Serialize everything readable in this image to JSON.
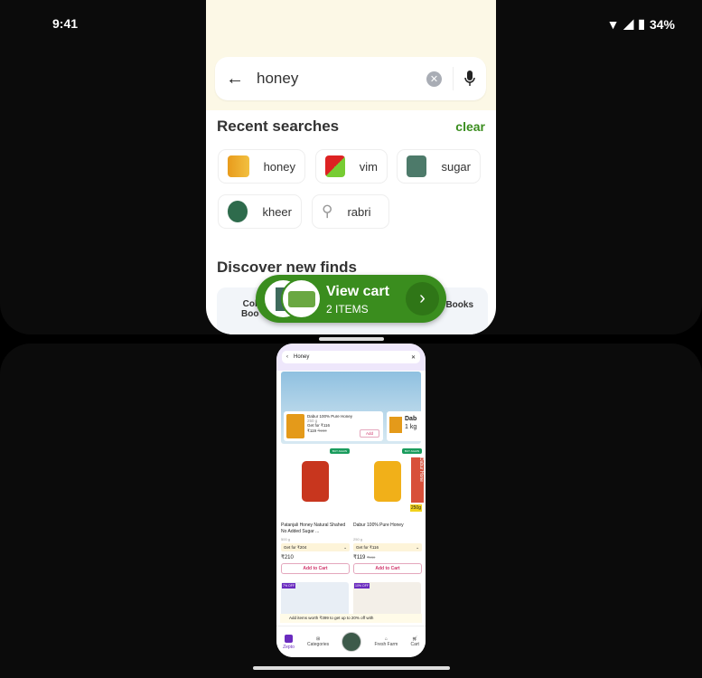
{
  "status": {
    "time": "9:41",
    "battery": "34%"
  },
  "search": {
    "query": "honey"
  },
  "recent": {
    "title": "Recent searches",
    "clear": "clear",
    "items": [
      "honey",
      "vim",
      "sugar",
      "kheer",
      "rabri"
    ]
  },
  "discover": {
    "title": "Discover new finds",
    "cat_left_1": "Col",
    "cat_left_2": "Boo",
    "cat_right": "Books"
  },
  "cart": {
    "label": "View cart",
    "count": "2 ITEMS"
  },
  "colors": {
    "accent": "#3a8d1e",
    "header_bg": "#fcf8e6"
  },
  "mini": {
    "search": "Honey",
    "banner_card": {
      "name": "Dabur 100% Pure Honey",
      "weight": "250 g",
      "offer": "Get for ₹116",
      "price": "₹119",
      "mrp": "₹150",
      "add": "Add"
    },
    "banner_card2": {
      "name": "Dab",
      "weight": "1 kg"
    },
    "products": [
      {
        "badge": "BUY AGAIN",
        "name": "Patanjali Honey Natural Shahed No Added Sugar ...",
        "weight": "500 g",
        "offer": "Get for ₹204",
        "price": "₹210",
        "mrp": "",
        "add": "Add to Cart"
      },
      {
        "badge": "BUY AGAIN",
        "name": "Dabur 100% Pure Honey",
        "weight": "250 g",
        "offer": "Get for ₹116",
        "price": "₹119",
        "mrp": "₹150",
        "add": "Add to Cart",
        "side": "Dabur Hone",
        "tag": "250g"
      }
    ],
    "discounts": [
      "7% OFF",
      "10% OFF"
    ],
    "promo": "Add items worth ₹399 to get up to 20% off with",
    "nav": [
      "Zepto",
      "Categories",
      "",
      "Fresh Farm",
      "Cart"
    ]
  }
}
